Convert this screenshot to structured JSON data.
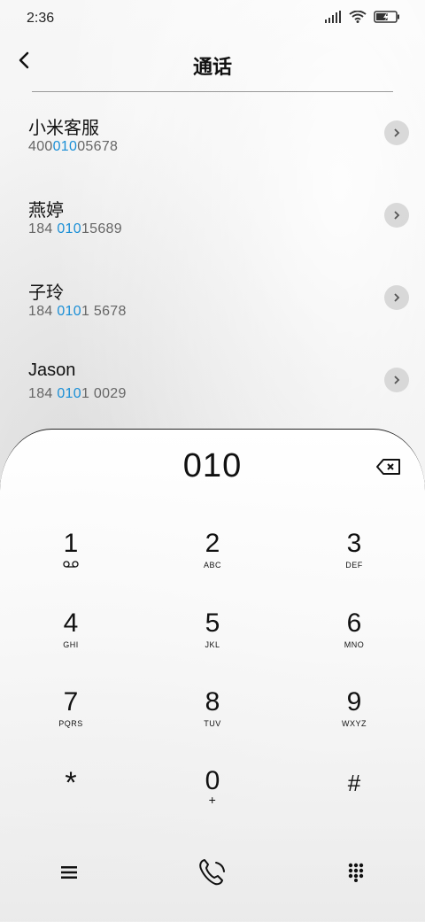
{
  "status": {
    "time": "2:36",
    "battery_level": 0.6
  },
  "header": {
    "title": "通话",
    "back_icon": "back-arrow-icon"
  },
  "contacts": [
    {
      "name": "小米客服",
      "number_parts": [
        "400",
        "010",
        "05678"
      ]
    },
    {
      "name": "燕婷",
      "number_parts": [
        "184 ",
        "010",
        "15689"
      ]
    },
    {
      "name": "子玲",
      "number_parts": [
        "184 ",
        "010",
        "1 5678"
      ]
    },
    {
      "name": "Jason",
      "number_parts": [
        "184 ",
        "010",
        "1 0029"
      ]
    }
  ],
  "colors": {
    "highlight": "#1b8fd6"
  },
  "dialpad": {
    "entered": "010",
    "keys": [
      {
        "digit": "1",
        "sub": "voicemail-icon"
      },
      {
        "digit": "2",
        "sub": "ABC"
      },
      {
        "digit": "3",
        "sub": "DEF"
      },
      {
        "digit": "4",
        "sub": "GHI"
      },
      {
        "digit": "5",
        "sub": "JKL"
      },
      {
        "digit": "6",
        "sub": "MNO"
      },
      {
        "digit": "7",
        "sub": "PQRS"
      },
      {
        "digit": "8",
        "sub": "TUV"
      },
      {
        "digit": "9",
        "sub": "WXYZ"
      },
      {
        "digit": "*",
        "sub": ""
      },
      {
        "digit": "0",
        "sub": "+"
      },
      {
        "digit": "#",
        "sub": ""
      }
    ]
  },
  "bottom_bar": [
    "menu-icon",
    "call-icon",
    "dialpad-toggle-icon"
  ]
}
